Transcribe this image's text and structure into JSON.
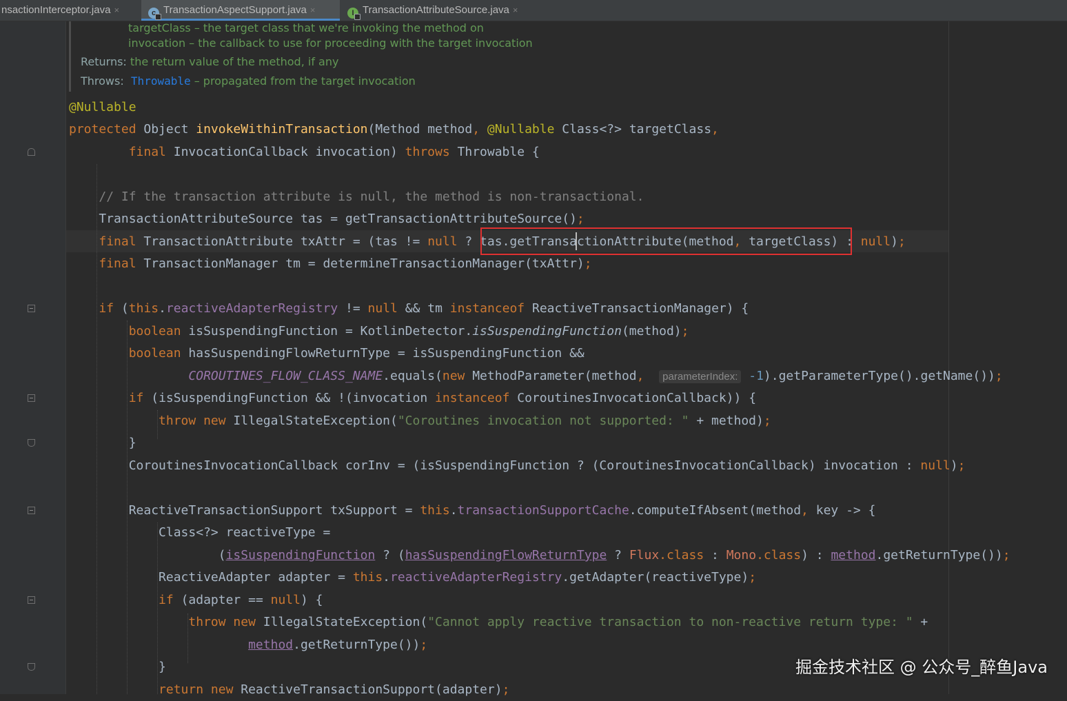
{
  "tabs": [
    {
      "label": "nsactionInterceptor.java",
      "close": "×",
      "icon": ""
    },
    {
      "label": "TransactionAspectSupport.java",
      "close": "×",
      "icon": "class-file-icon",
      "icon_glyph": "c"
    },
    {
      "label": "TransactionAttributeSource.java",
      "close": "×",
      "icon": "interface-file-icon",
      "icon_glyph": "I"
    }
  ],
  "doc": {
    "param_target": "targetClass – the target class that we're invoking the method on",
    "param_invocation": "invocation – the callback to use for proceeding with the target invocation",
    "returns_label": "Returns:",
    "returns_text": "the return value of the method, if any",
    "throws_label": "Throws:",
    "throws_link": "Throwable",
    "throws_text": " – propagated from the target invocation"
  },
  "hint": {
    "param_index": "parameterIndex:"
  },
  "watermark": "掘金技术社区 @ 公众号_醉鱼Java",
  "colors": {
    "keyword": "#cc7832",
    "annotation": "#bbb529",
    "method": "#ffc66d",
    "comment": "#808080",
    "string": "#6a8759",
    "field": "#9876aa",
    "number": "#6897bb",
    "highlight_box": "#e03131"
  }
}
